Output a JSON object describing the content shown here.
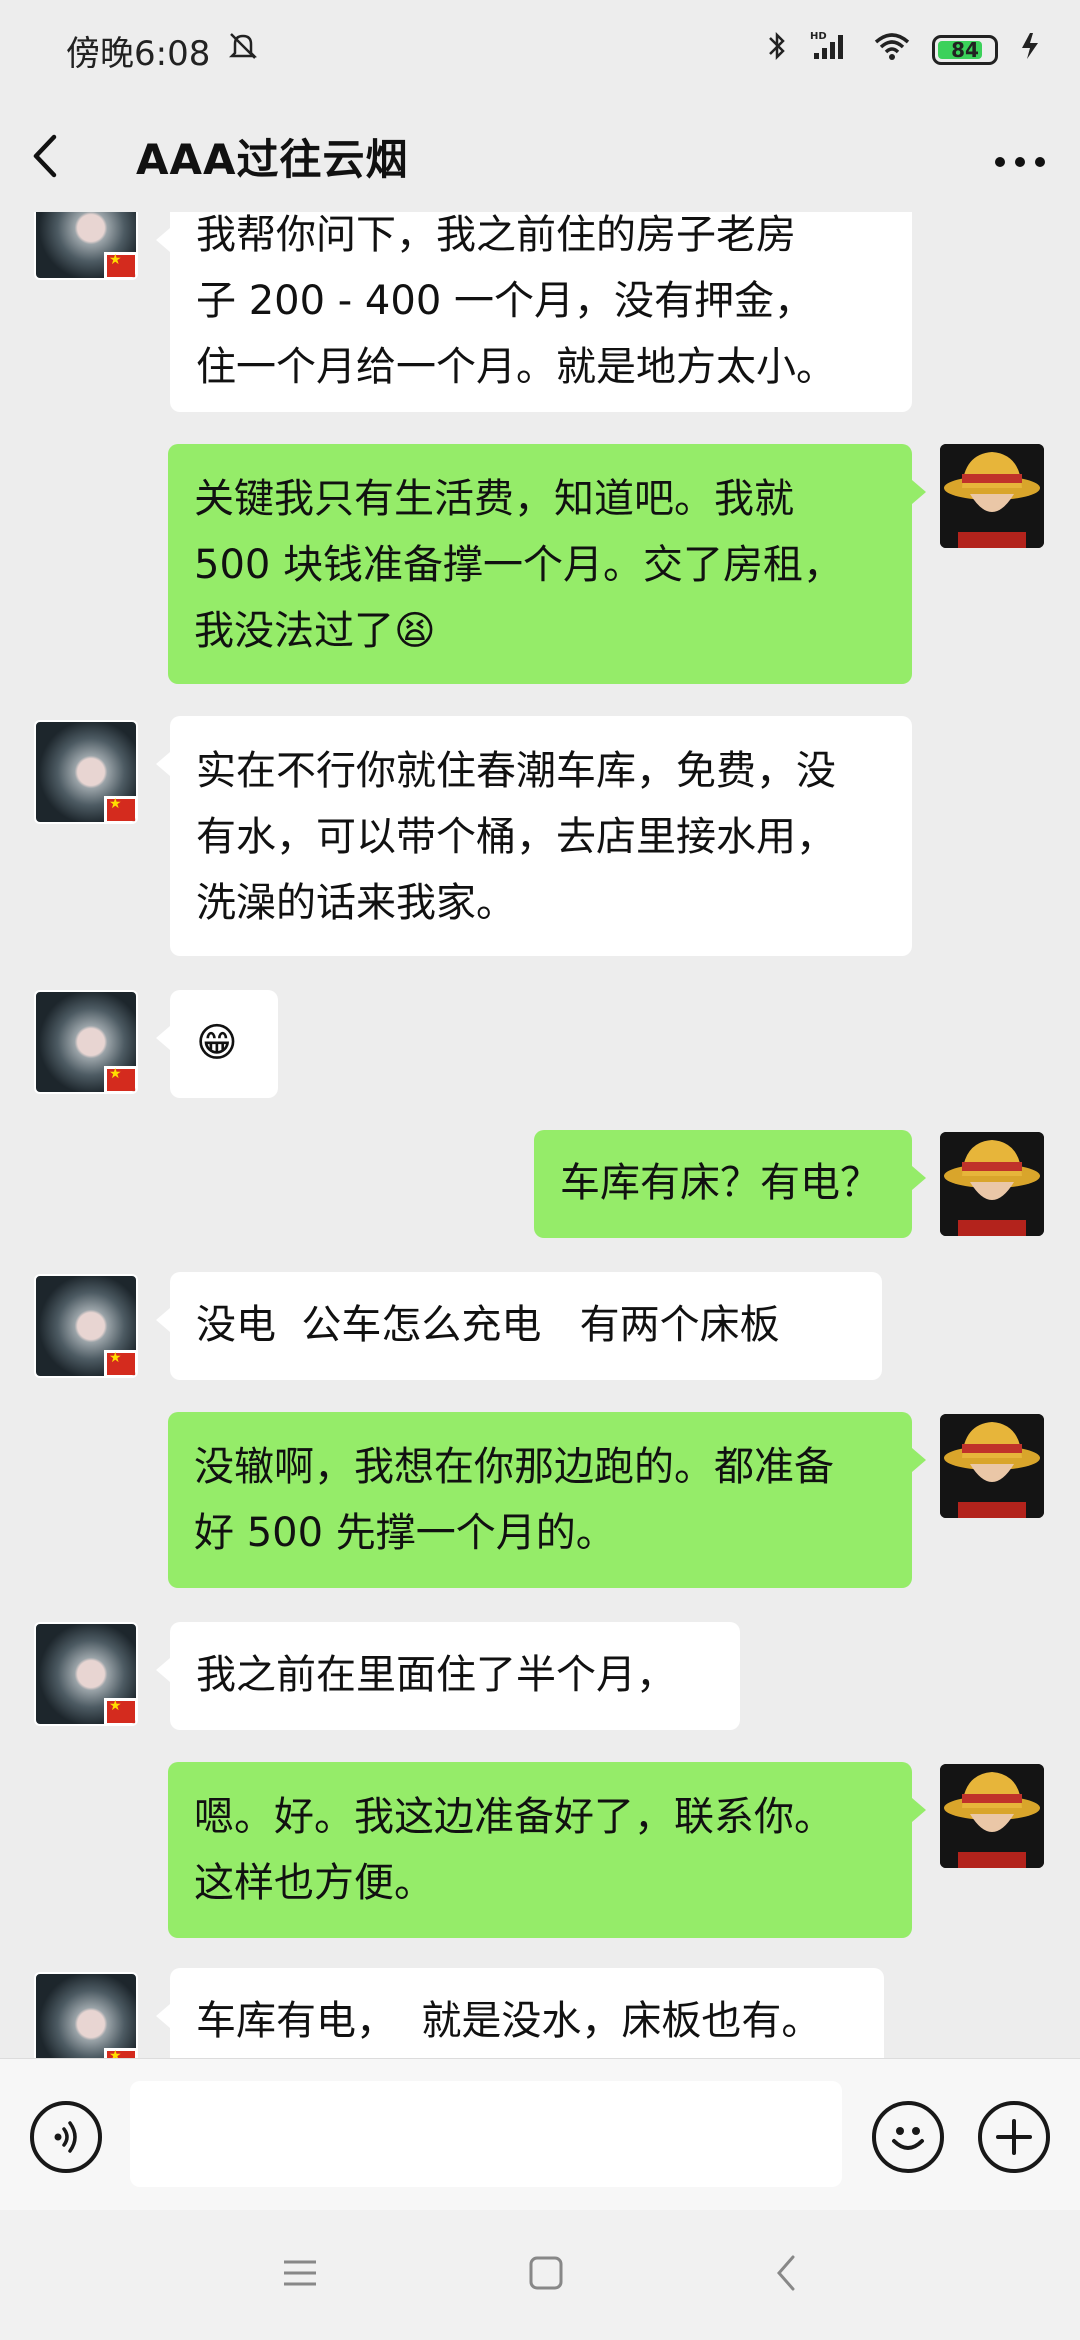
{
  "status_bar": {
    "time": "傍晚6:08",
    "battery": "84"
  },
  "header": {
    "title": "AAA过往云烟"
  },
  "messages": [
    {
      "sender": "them",
      "text": "我帮你问下，我之前住的房子老房\n子 200 - 400 一个月，没有押金，\n住一个月给一个月。就是地方太小。"
    },
    {
      "sender": "me",
      "text": "关键我只有生活费，知道吧。我就\n500 块钱准备撑一个月。交了房租，\n我没法过了😫"
    },
    {
      "sender": "them",
      "text": "实在不行你就住春潮车库，免费，没\n有水，可以带个桶，去店里接水用，\n洗澡的话来我家。"
    },
    {
      "sender": "them",
      "text": "😁"
    },
    {
      "sender": "me",
      "text": "车库有床？有电？"
    },
    {
      "sender": "them",
      "text": "没电  公车怎么充电   有两个床板"
    },
    {
      "sender": "me",
      "text": "没辙啊，我想在你那边跑的。都准备\n好 500 先撑一个月的。"
    },
    {
      "sender": "them",
      "text": "我之前在里面住了半个月，"
    },
    {
      "sender": "me",
      "text": "嗯。好。我这边准备好了，联系你。\n这样也方便。"
    },
    {
      "sender": "them",
      "text": "车库有电，  就是没水，床板也有。"
    }
  ],
  "input": {
    "placeholder": ""
  },
  "icons": {
    "back": "chevron-left-icon",
    "more": "more-icon",
    "voice": "voice-icon",
    "emoji": "emoji-icon",
    "plus": "plus-icon"
  },
  "colors": {
    "my_bubble": "#95ec69",
    "their_bubble": "#ffffff",
    "background": "#ededed"
  }
}
